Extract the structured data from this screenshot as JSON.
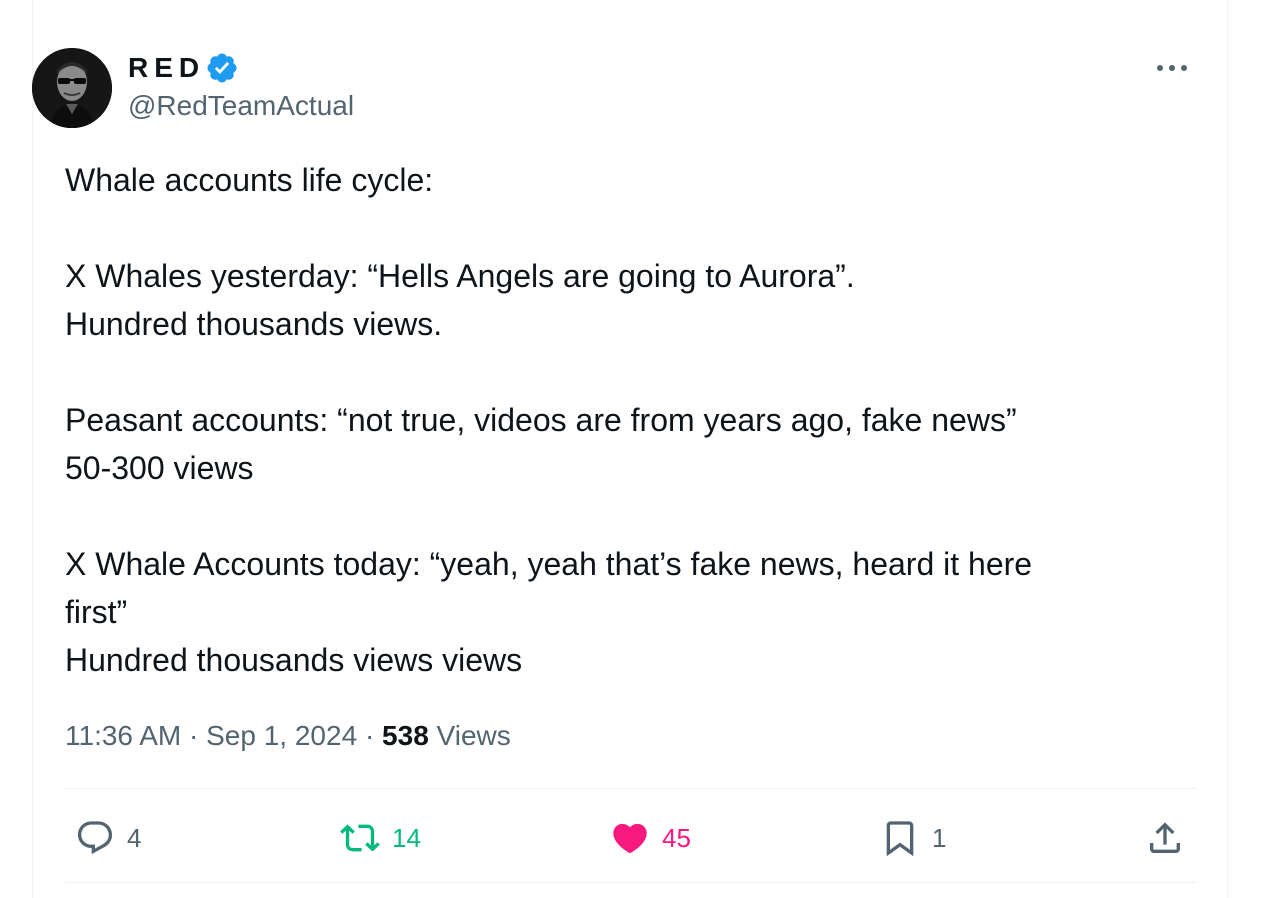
{
  "author": {
    "display_name": "RED",
    "handle": "@RedTeamActual",
    "verified": true,
    "verified_color": "#1d9bf0"
  },
  "tweet": {
    "lines": [
      "Whale accounts life cycle:",
      "",
      "X Whales yesterday: “Hells Angels are going to Aurora”.",
      "Hundred thousands views.",
      "",
      "Peasant accounts: “not true, videos are from years ago, fake news”",
      "50-300 views",
      "",
      "X Whale Accounts today: “yeah, yeah that’s fake news, heard it here",
      "first”",
      "Hundred thousands views views"
    ]
  },
  "meta": {
    "time": "11:36 AM",
    "separator": "·",
    "date": "Sep 1, 2024",
    "views_count": "538",
    "views_label": "Views"
  },
  "actions": {
    "replies": "4",
    "retweets": "14",
    "likes": "45",
    "bookmarks": "1"
  },
  "colors": {
    "text": "#0f1419",
    "secondary": "#536471",
    "retweet": "#00ba7c",
    "like": "#f91880",
    "divider": "#eff3f4"
  },
  "icons": {
    "more": "more-horizontal-icon",
    "reply": "reply-icon",
    "retweet": "retweet-icon",
    "like": "heart-icon",
    "bookmark": "bookmark-icon",
    "share": "share-icon"
  }
}
